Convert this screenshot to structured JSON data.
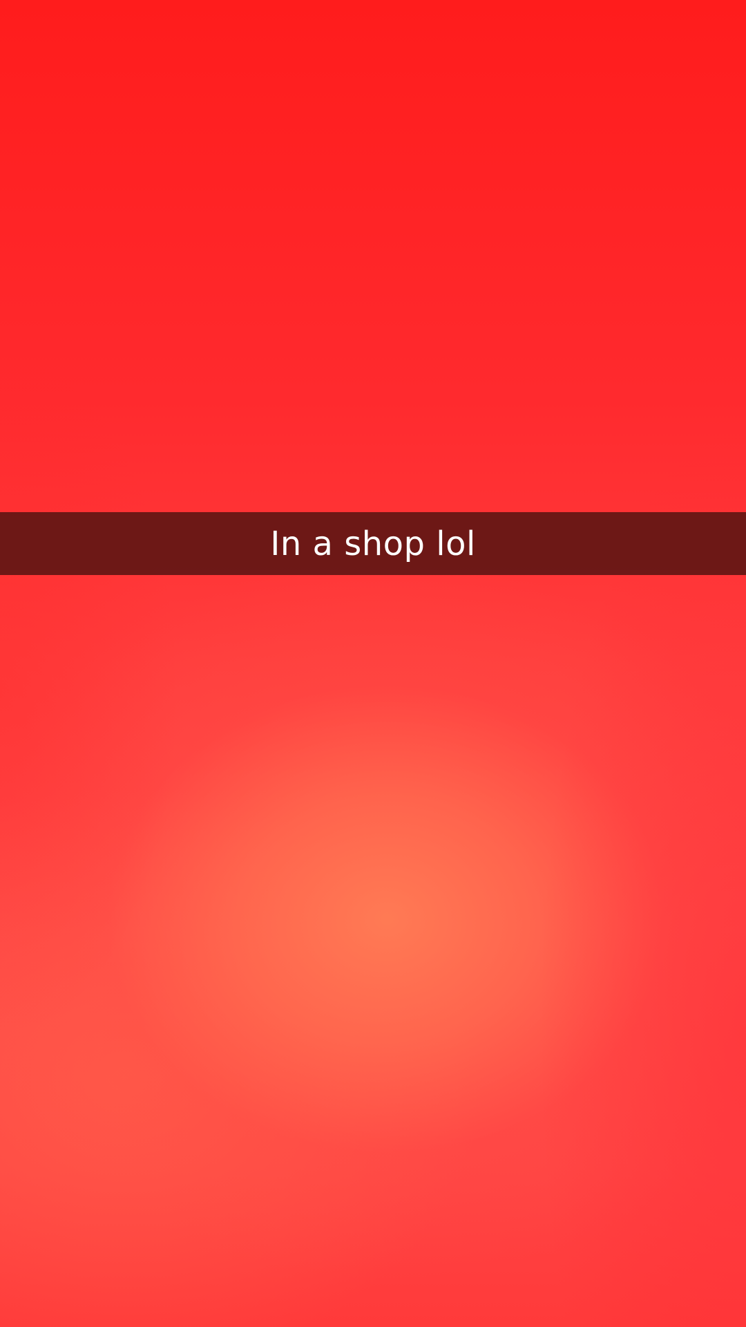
{
  "snap": {
    "caption": "In a shop lol"
  },
  "colors": {
    "photo_top": "#ff1c1c",
    "photo_glow": "#ff7d55",
    "caption_bar": "#551412",
    "caption_text": "#ffffff"
  }
}
